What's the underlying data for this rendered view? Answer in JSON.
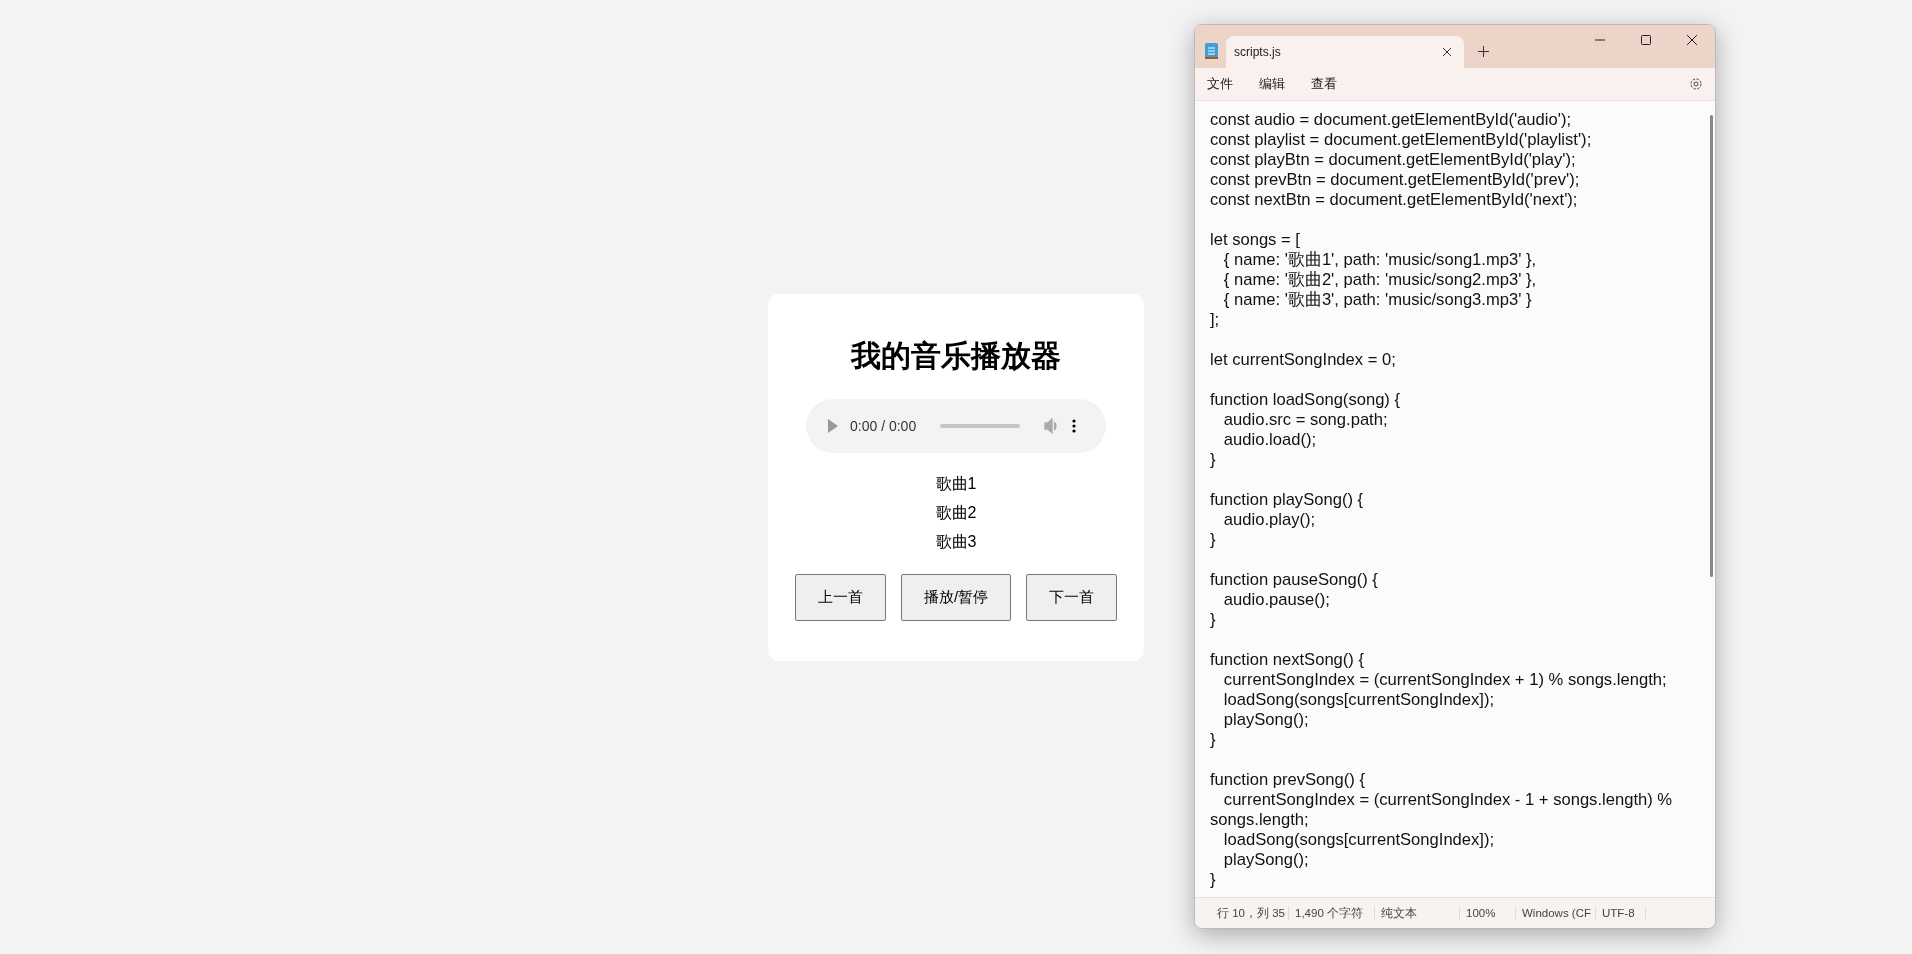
{
  "player": {
    "title": "我的音乐播放器",
    "audio": {
      "time": "0:00 / 0:00"
    },
    "playlist": [
      "歌曲1",
      "歌曲2",
      "歌曲3"
    ],
    "buttons": [
      "上一首",
      "播放/暂停",
      "下一首"
    ]
  },
  "notepad": {
    "tabs": [
      {
        "label": "scripts.js",
        "selected": true
      }
    ],
    "menu": [
      "文件",
      "编辑",
      "查看"
    ],
    "code_blocks": [
      [
        "const audio = document.getElementById('audio');",
        "const playlist = document.getElementById('playlist');",
        "const playBtn = document.getElementById('play');",
        "const prevBtn = document.getElementById('prev');",
        "const nextBtn = document.getElementById('next');"
      ],
      [
        "let songs = [",
        "   { name: '歌曲1', path: 'music/song1.mp3' },",
        "   { name: '歌曲2', path: 'music/song2.mp3' },",
        "   { name: '歌曲3', path: 'music/song3.mp3' }",
        "];"
      ],
      [
        "let currentSongIndex = 0;"
      ],
      [
        "function loadSong(song) {",
        "   audio.src = song.path;",
        "   audio.load();",
        "}"
      ],
      [
        "function playSong() {",
        "   audio.play();",
        "}"
      ],
      [
        "function pauseSong() {",
        "   audio.pause();",
        "}"
      ],
      [
        "function nextSong() {",
        "   currentSongIndex = (currentSongIndex + 1) % songs.length;",
        "   loadSong(songs[currentSongIndex]);",
        "   playSong();",
        "}"
      ],
      [
        "function prevSong() {",
        "   currentSongIndex = (currentSongIndex - 1 + songs.length) %",
        "songs.length;",
        "   loadSong(songs[currentSongIndex]);",
        "   playSong();",
        "}"
      ]
    ],
    "status_bar": [
      "行 10，列 35",
      "1,490 个字符",
      "纯文本",
      "100%",
      "Windows (CF",
      "UTF-8"
    ]
  }
}
